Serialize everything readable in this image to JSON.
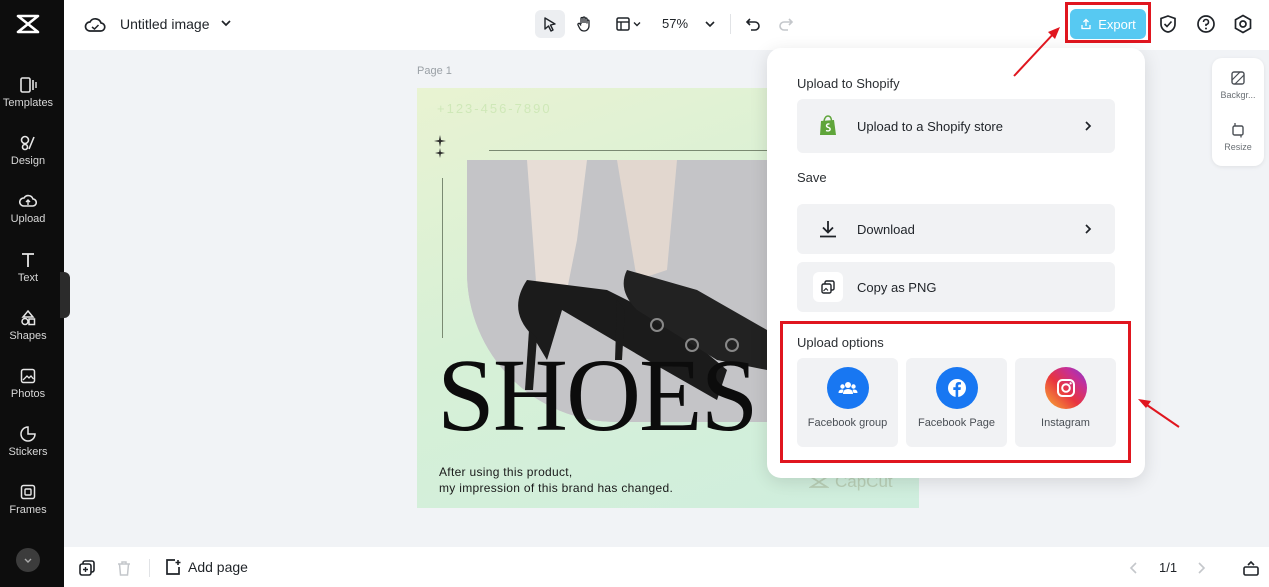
{
  "sidebar": {
    "items": [
      {
        "label": "Templates",
        "icon": "templates-icon"
      },
      {
        "label": "Design",
        "icon": "design-icon"
      },
      {
        "label": "Upload",
        "icon": "upload-icon"
      },
      {
        "label": "Text",
        "icon": "text-icon"
      },
      {
        "label": "Shapes",
        "icon": "shapes-icon"
      },
      {
        "label": "Photos",
        "icon": "photos-icon"
      },
      {
        "label": "Stickers",
        "icon": "stickers-icon"
      },
      {
        "label": "Frames",
        "icon": "frames-icon"
      }
    ]
  },
  "topbar": {
    "title": "Untitled image",
    "zoom": "57%",
    "export_label": "Export"
  },
  "canvas": {
    "page_label": "Page 1",
    "phone": "+123-456-7890",
    "headline": "SHOES",
    "tagline_line1": "After using this product,",
    "tagline_line2": "my impression of this brand has changed.",
    "watermark": "CapCut"
  },
  "float_panel": {
    "background_label": "Backgr...",
    "resize_label": "Resize"
  },
  "export_menu": {
    "shopify_section": "Upload to Shopify",
    "shopify_row": "Upload to a Shopify store",
    "save_section": "Save",
    "download_row": "Download",
    "copy_row": "Copy as PNG",
    "upload_section": "Upload options",
    "options": [
      {
        "label": "Facebook group"
      },
      {
        "label": "Facebook Page"
      },
      {
        "label": "Instagram"
      }
    ]
  },
  "bottombar": {
    "add_page": "Add page",
    "page_count": "1/1"
  },
  "colors": {
    "accent": "#57c9f2",
    "highlight": "#e0161f",
    "facebook": "#1877f2",
    "shopify": "#5fa53a"
  }
}
